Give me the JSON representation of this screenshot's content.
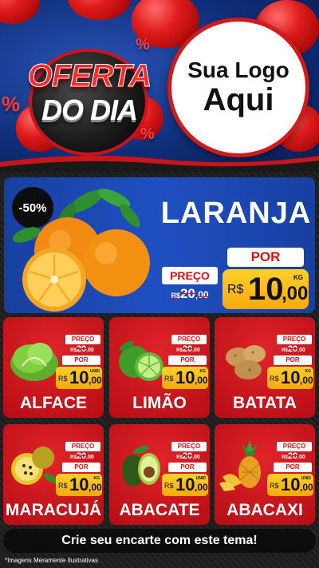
{
  "header": {
    "badge": {
      "line1": "OFERTA",
      "line2": "DO DIA",
      "symbol": "%"
    },
    "logo": {
      "line1": "Sua Logo",
      "line2": "Aqui"
    }
  },
  "featured": {
    "discount": "-50%",
    "name": "LARANJA",
    "preco_label": "PREÇO",
    "old_price": {
      "currency": "R$",
      "integer": "20",
      "cents": ",00"
    },
    "por_label": "POR",
    "new_price": {
      "currency": "R$",
      "integer": "10",
      "cents": ",00",
      "unit": "KG"
    }
  },
  "products": [
    {
      "name": "ALFACE",
      "preco_label": "PREÇO",
      "old_currency": "R$",
      "old_int": "20",
      "old_cents": ",00",
      "por_label": "POR",
      "currency": "R$",
      "int": "10",
      "cents": ",00",
      "unit": "UNID",
      "icon": "lettuce-icon"
    },
    {
      "name": "LIMÃO",
      "preco_label": "PREÇO",
      "old_currency": "R$",
      "old_int": "20",
      "old_cents": ",00",
      "por_label": "POR",
      "currency": "R$",
      "int": "10",
      "cents": ",00",
      "unit": "KG",
      "icon": "lime-icon"
    },
    {
      "name": "BATATA",
      "preco_label": "PREÇO",
      "old_currency": "R$",
      "old_int": "20",
      "old_cents": ",00",
      "por_label": "POR",
      "currency": "R$",
      "int": "10",
      "cents": ",00",
      "unit": "KG",
      "icon": "potato-icon"
    },
    {
      "name": "MARACUJÁ",
      "preco_label": "PREÇO",
      "old_currency": "R$",
      "old_int": "20",
      "old_cents": ",00",
      "por_label": "POR",
      "currency": "R$",
      "int": "10",
      "cents": ",00",
      "unit": "KG",
      "icon": "passion-fruit-icon"
    },
    {
      "name": "ABACATE",
      "preco_label": "PREÇO",
      "old_currency": "R$",
      "old_int": "20",
      "old_cents": ",00",
      "por_label": "POR",
      "currency": "R$",
      "int": "10",
      "cents": ",00",
      "unit": "UNID",
      "icon": "avocado-icon"
    },
    {
      "name": "ABACAXI",
      "preco_label": "PREÇO",
      "old_currency": "R$",
      "old_int": "20",
      "old_cents": ",00",
      "por_label": "POR",
      "currency": "R$",
      "int": "10",
      "cents": ",00",
      "unit": "UNID",
      "icon": "pineapple-icon"
    }
  ],
  "footer": {
    "cta": "Crie seu encarte com este tema!",
    "disclaimer": "*Imagens Meramente Ilustrativas"
  },
  "colors": {
    "header_blue": "#1f4fc1",
    "card_red": "#d11a20",
    "price_yellow": "#f9b916",
    "dark_bg": "#1a1a1a"
  }
}
